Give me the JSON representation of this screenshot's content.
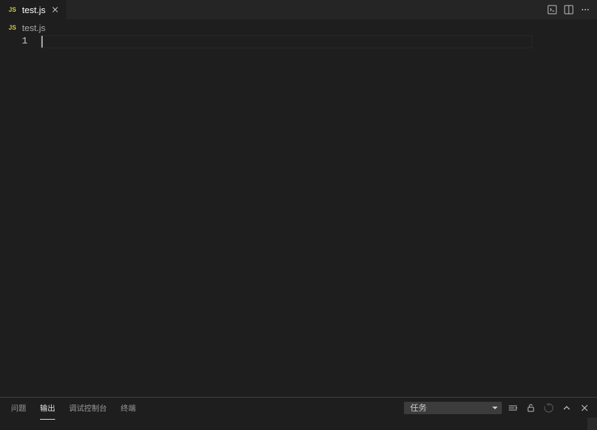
{
  "tab": {
    "filename": "test.js",
    "icon_text": "JS"
  },
  "breadcrumb": {
    "filename": "test.js",
    "icon_text": "JS"
  },
  "editor": {
    "line_number": "1"
  },
  "panel": {
    "tabs": {
      "problems": "问题",
      "output": "输出",
      "debug_console": "调试控制台",
      "terminal": "终端"
    },
    "active_tab": "output",
    "select_value": "任务"
  }
}
